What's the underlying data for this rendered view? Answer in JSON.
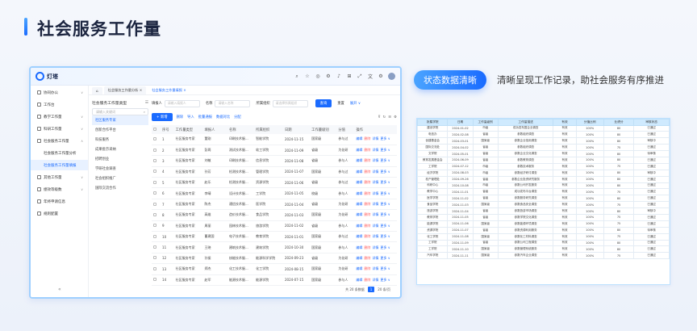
{
  "hero_title": "社会服务工作量",
  "app": {
    "logo_text": "灯塔",
    "top_icons": [
      "search-icon",
      "star-icon",
      "chat-icon",
      "settings-icon",
      "bell-icon",
      "grid-icon",
      "expand-icon",
      "translate-icon",
      "gear-icon"
    ],
    "sidebar": [
      {
        "label": "协同办公",
        "sub": false,
        "active": false,
        "chev": "∨"
      },
      {
        "label": "工作台",
        "sub": false,
        "active": false,
        "chev": ""
      },
      {
        "label": "教学工作量",
        "sub": false,
        "active": false,
        "chev": "∨"
      },
      {
        "label": "科研工作量",
        "sub": false,
        "active": false,
        "chev": "∨"
      },
      {
        "label": "社会服务工作量",
        "sub": false,
        "active": false,
        "chev": "∧"
      },
      {
        "label": "社会服务工作量分析",
        "sub": true,
        "active": false,
        "chev": ""
      },
      {
        "label": "社会服务工作量填报",
        "sub": true,
        "active": true,
        "chev": ""
      },
      {
        "label": "其他工作量",
        "sub": false,
        "active": false,
        "chev": "∨"
      },
      {
        "label": "绩效等级数",
        "sub": false,
        "active": false,
        "chev": "∨"
      },
      {
        "label": "年终申请信息",
        "sub": false,
        "active": false,
        "chev": ""
      },
      {
        "label": "规则配置",
        "sub": false,
        "active": false,
        "chev": ""
      }
    ],
    "collapse_label": "«",
    "tabs": [
      {
        "label": "社会服务工作量分析 ×",
        "active": false
      },
      {
        "label": "社会服务工作量填报 ×",
        "active": true
      }
    ],
    "tree": {
      "title": "社会服务工作量类型",
      "menu_label": "☰",
      "search_placeholder": "请输入关键词",
      "items": [
        "社区服务专家",
        "创新合作平台",
        "科技服务",
        "成果批示采纳",
        "招聘创业",
        "学研社会调查",
        "社会组织推广",
        "国际交流合作"
      ]
    },
    "filter": {
      "reporter_label": "填报人",
      "reporter_placeholder": "请输入填报人",
      "name_label": "名称",
      "name_placeholder": "请输入名称",
      "org_label": "所属组织",
      "org_placeholder": "请选择所属组织",
      "query": "查询",
      "reset": "重置",
      "expand": "展开 ∨"
    },
    "toolbar": {
      "new": "+ 新增",
      "delete": "删除",
      "import": "导入",
      "batch": "批量通报",
      "data_compare": "数据对比",
      "share": "分配",
      "right_icons": [
        "filter-icon",
        "refresh-icon",
        "column-icon",
        "settings-icon"
      ]
    },
    "columns": [
      "序号",
      "工作量类型",
      "填报人",
      "名称",
      "所属组织",
      "日期",
      "工作量级别",
      "分值",
      "操作"
    ],
    "rows": [
      [
        "1",
        "社区服务专家",
        "董刚",
        "印刷技术服...",
        "智能学院",
        "2024-11-15",
        "国家级",
        "参与过"
      ],
      [
        "2",
        "社区服务专家",
        "彭两",
        "测试技术服...",
        "软工学院",
        "2024-11-09",
        "省级",
        "为化研"
      ],
      [
        "3",
        "社区服务专家",
        "刘敏",
        "印刷技术服...",
        "信息学院",
        "2024-11-08",
        "省级",
        "参与人"
      ],
      [
        "4",
        "社区服务专家",
        "孙芳",
        "检测技术服...",
        "管理学院",
        "2024-11-07",
        "国家级",
        "参与过"
      ],
      [
        "5",
        "社区服务专家",
        "赵乐",
        "检测技术服...",
        "资源学院",
        "2024-11-06",
        "省级",
        "参与过"
      ],
      [
        "6",
        "社区服务专家",
        "李晴",
        "设计技术服...",
        "工学院",
        "2024-11-05",
        "校级",
        "参与人"
      ],
      [
        "7",
        "社区服务专家",
        "陈杰",
        "通信技术服...",
        "医学院",
        "2024-11-04",
        "省级",
        "为化研"
      ],
      [
        "8",
        "社区服务专家",
        "高维",
        "造价技术服...",
        "食品学院",
        "2024-11-03",
        "国家级",
        "为化研"
      ],
      [
        "9",
        "社区服务专家",
        "周丽",
        "园林技术服...",
        "旅游学院",
        "2024-11-02",
        "省级",
        "参与人"
      ],
      [
        "10",
        "社区服务专家",
        "曹建国",
        "电子技术服...",
        "教育学院",
        "2024-11-01",
        "国家级",
        "参与过"
      ],
      [
        "11",
        "社区服务专家",
        "王晓",
        "建筑技术服...",
        "建筑学院",
        "2024-10-30",
        "国家级",
        "参与人"
      ],
      [
        "12",
        "社区服务专家",
        "孙振",
        "核能技术服...",
        "能源科学学院",
        "2024-09-23",
        "省级",
        "为化研"
      ],
      [
        "13",
        "社区服务专家",
        "郑杰",
        "化工技术服...",
        "化工学院",
        "2024-08-15",
        "国家级",
        "为化研"
      ],
      [
        "14",
        "社区服务专家",
        "赵军",
        "能源技术服...",
        "能源学院",
        "2024-07-15",
        "国家级",
        "参与人"
      ]
    ],
    "ops": {
      "view": "编辑",
      "del": "删除",
      "detail": "详情",
      "more": "更多 ∨"
    },
    "pager": {
      "total": "共 20 条数据",
      "page": "1",
      "per_page": "20 条/页"
    }
  },
  "feature": {
    "pill": "状态数据清晰",
    "desc": "清晰呈现工作记录，助社会服务有序推进"
  },
  "sheet": {
    "columns": [
      "所属学院",
      "日期",
      "工作量级别",
      "工作量描述",
      "有效",
      "分值比例",
      "业绩分",
      "审核状态"
    ],
    "rows": [
      [
        "建设学院",
        "2024-01-02",
        "市级",
        "成功发布国企业调查",
        "有效",
        "100%",
        "80",
        "已通过"
      ],
      [
        "电信办",
        "2024-02-08",
        "省级",
        "参数组织调查",
        "有效",
        "100%",
        "80",
        "已通过"
      ],
      [
        "创建基金会",
        "2024-03-01",
        "国家级",
        "参数企业信用调查",
        "有效",
        "100%",
        "80",
        "审核中"
      ],
      [
        "国际交流处",
        "2024-04-02",
        "省级",
        "参数组织调查",
        "有效",
        "100%",
        "75",
        "已通过"
      ],
      [
        "文学院",
        "2024-05-01",
        "省级",
        "参数企业文化调查",
        "有效",
        "100%",
        "80",
        "待审核"
      ],
      [
        "教育发展基金会",
        "2024-06-09",
        "省级",
        "参数教育调查",
        "有效",
        "100%",
        "80",
        "已通过"
      ],
      [
        "工学院",
        "2024-07-12",
        "市级",
        "参数技术服务",
        "有效",
        "100%",
        "75",
        "已通过"
      ],
      [
        "经济学院",
        "2024-08-03",
        "市级",
        "参数经济研讨调查",
        "有效",
        "100%",
        "80",
        "审核中"
      ],
      [
        "校产管理处",
        "2024-09-26",
        "省级",
        "参数企业投资研究服务",
        "有效",
        "100%",
        "80",
        "已通过"
      ],
      [
        "科研中心",
        "2024-10-08",
        "市级",
        "参数公司开发服务",
        "有效",
        "100%",
        "80",
        "已通过"
      ],
      [
        "教学中心",
        "2024-11-01",
        "省级",
        "成功发布平台调查",
        "有效",
        "100%",
        "75",
        "已通过"
      ],
      [
        "医学学院",
        "2024-11-02",
        "省级",
        "参数服务研究调查",
        "有效",
        "100%",
        "80",
        "已通过"
      ],
      [
        "食品学院",
        "2024-11-03",
        "国家级",
        "参数食品安全调查",
        "有效",
        "100%",
        "75",
        "已通过"
      ],
      [
        "旅游学院",
        "2024-11-04",
        "省级",
        "参数旅游市场调查",
        "有效",
        "100%",
        "80",
        "审核中"
      ],
      [
        "教育学院",
        "2024-11-05",
        "省级",
        "参数学院文化调查",
        "有效",
        "100%",
        "75",
        "已通过"
      ],
      [
        "能源学院",
        "2024-11-06",
        "国家级",
        "参数能源环境调查",
        "有效",
        "100%",
        "75",
        "已通过"
      ],
      [
        "资源学院",
        "2024-11-07",
        "省级",
        "参数资源利用服务",
        "有效",
        "100%",
        "80",
        "待审核"
      ],
      [
        "化工学院",
        "2024-11-08",
        "国家级",
        "参数化工材料调查",
        "有效",
        "100%",
        "75",
        "已通过"
      ],
      [
        "工学院",
        "2024-11-09",
        "省级",
        "参数公司工程调查",
        "有效",
        "100%",
        "80",
        "已通过"
      ],
      [
        "工学院",
        "2024-11-10",
        "国家级",
        "参数管理系统服务",
        "有效",
        "100%",
        "80",
        "已通过"
      ],
      [
        "汽车学院",
        "2024-11-11",
        "国家级",
        "参数汽车企业调查",
        "有效",
        "100%",
        "75",
        "已通过"
      ]
    ]
  }
}
